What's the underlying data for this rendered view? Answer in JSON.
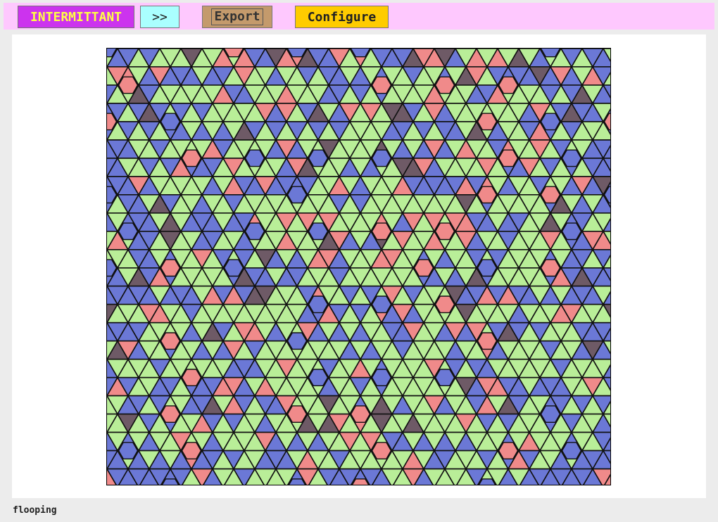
{
  "toolbar": {
    "mode_label": "INTERMITTANT",
    "next_label": ">>",
    "export_label": "Export",
    "configure_label": "Configure"
  },
  "status": {
    "text": "flooping"
  },
  "colors": {
    "toolbar_bg": "#fec8fe",
    "mode_bg": "#cc33ee",
    "mode_fg": "#ffff44",
    "next_bg": "#aaffff",
    "export_bg": "#c49a6c",
    "configure_bg": "#ffcc00",
    "tile_palette": [
      "#b9ee98",
      "#6b78d6",
      "#f08a8a",
      "#6e5a66"
    ]
  }
}
